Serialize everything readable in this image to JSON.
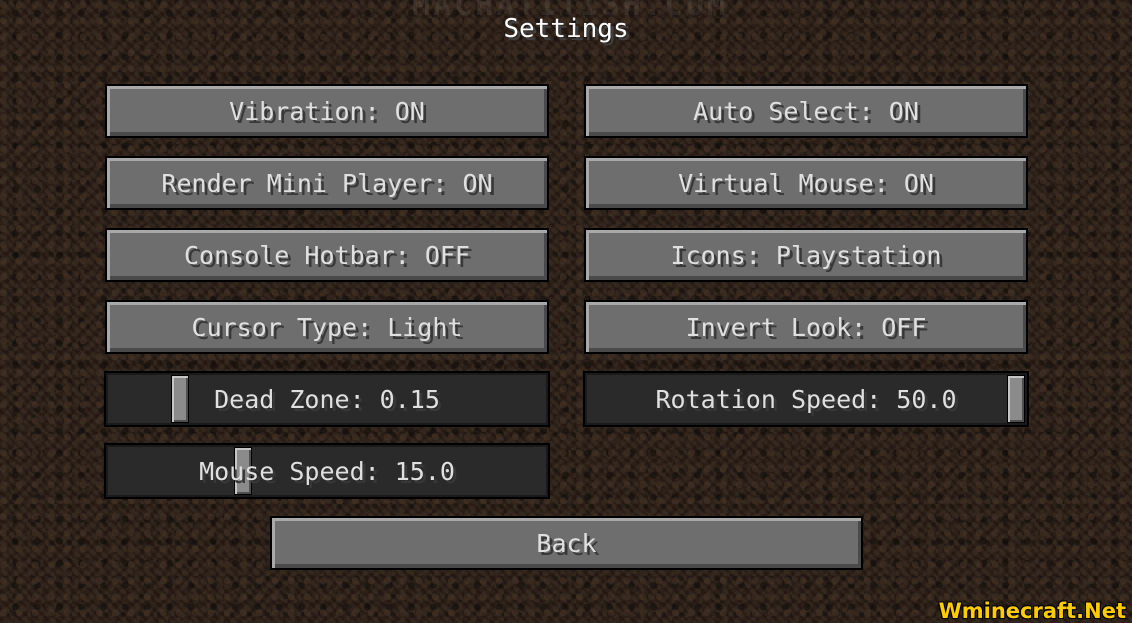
{
  "title": "Settings",
  "watermark_top": "MACHATITISH.COM",
  "buttons": {
    "vibration": "Vibration: ON",
    "auto_select": "Auto Select: ON",
    "render_mini_player": "Render Mini Player: ON",
    "virtual_mouse": "Virtual Mouse: ON",
    "console_hotbar": "Console Hotbar: OFF",
    "icons": "Icons: Playstation",
    "cursor_type": "Cursor Type: Light",
    "invert_look": "Invert Look: OFF",
    "back": "Back"
  },
  "sliders": {
    "dead_zone": {
      "label": "Dead Zone: 0.15",
      "fraction": 0.15
    },
    "rotation_speed": {
      "label": "Rotation Speed: 50.0",
      "fraction": 1.0
    },
    "mouse_speed": {
      "label": "Mouse Speed: 15.0",
      "fraction": 0.3
    }
  },
  "watermark_bottom": "Wminecraft.Net"
}
